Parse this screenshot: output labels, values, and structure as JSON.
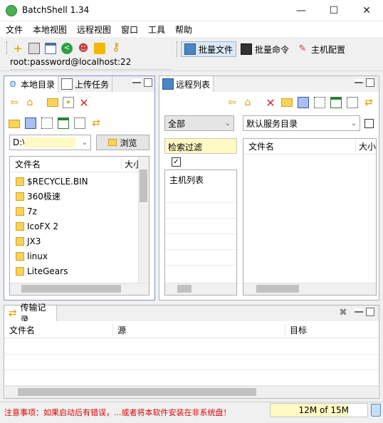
{
  "window": {
    "title": "BatchShell 1.34",
    "minimize": "—",
    "maximize": "☐",
    "close": "✕"
  },
  "menu": [
    "文件",
    "本地视图",
    "远程视图",
    "窗口",
    "工具",
    "帮助"
  ],
  "connection": {
    "address": "root:password@localhost:22"
  },
  "mode_tabs": {
    "batch_file": "批量文件",
    "batch_command": "批量命令",
    "host_config": "主机配置"
  },
  "local_panel": {
    "tab_local": "本地目录",
    "tab_upload": "上传任务",
    "drive": "D:\\",
    "browse": "浏览",
    "col_name": "文件名",
    "col_size": "大小",
    "files": [
      "$RECYCLE.BIN",
      "360极速",
      "7z",
      "IcoFX 2",
      "JX3",
      "linux",
      "LiteGears"
    ]
  },
  "remote_panel": {
    "tab_remote": "远程列表",
    "group_filter": "全部",
    "search_placeholder": "检索过滤",
    "host_list_label": "主机列表",
    "dir_select": "默认服务目录",
    "col_name": "文件名",
    "col_size": "大小"
  },
  "transfer_panel": {
    "tab": "传输记录",
    "col_name": "文件名",
    "col_source": "源",
    "col_target": "目标"
  },
  "status": {
    "notice": "注意事项：如果启动后有错误，...或者将本软件安装在非系统盘！",
    "memory": "12M of 15M",
    "memory_fraction": 0.8
  }
}
